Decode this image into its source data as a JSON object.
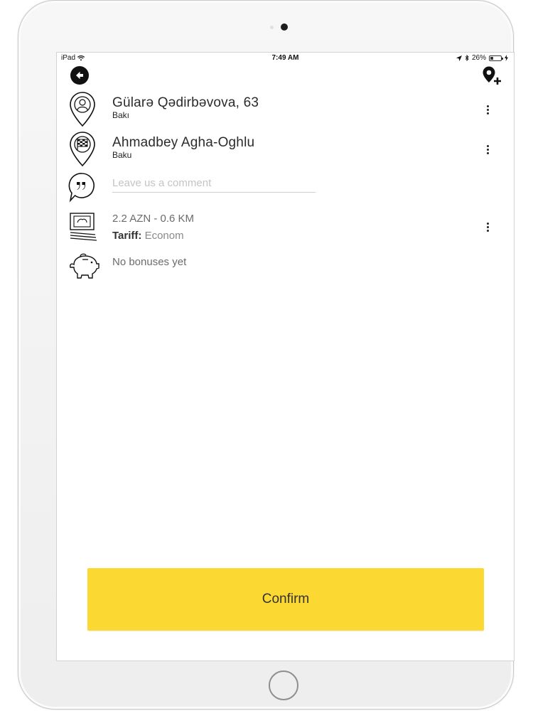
{
  "status_bar": {
    "device": "iPad",
    "time": "7:49 AM",
    "battery_percent": "26%",
    "battery_level": 0.26
  },
  "icons": {
    "back": "back-arrow-icon",
    "add_location": "add-location-pin-icon",
    "pickup": "pickup-pin-person-icon",
    "destination": "destination-pin-flag-icon",
    "comment": "comment-quote-bubble-icon",
    "fare": "money-bill-icon",
    "bonus": "piggy-bank-icon",
    "more": "more-vertical-icon"
  },
  "pickup": {
    "address": "Gülarə Qədirbəvova, 63",
    "city": "Bakı"
  },
  "destination": {
    "address": "Ahmadbey Agha-Oghlu",
    "city": "Baku"
  },
  "comment": {
    "placeholder": "Leave us a comment",
    "value": ""
  },
  "fare": {
    "price_distance": "2.2 AZN - 0.6 KM",
    "tariff_label": "Tariff:",
    "tariff_value": "Econom"
  },
  "bonus": {
    "text": "No bonuses yet"
  },
  "confirm": {
    "label": "Confirm"
  },
  "colors": {
    "confirm_button": "#fcd833",
    "icon": "#111111"
  }
}
